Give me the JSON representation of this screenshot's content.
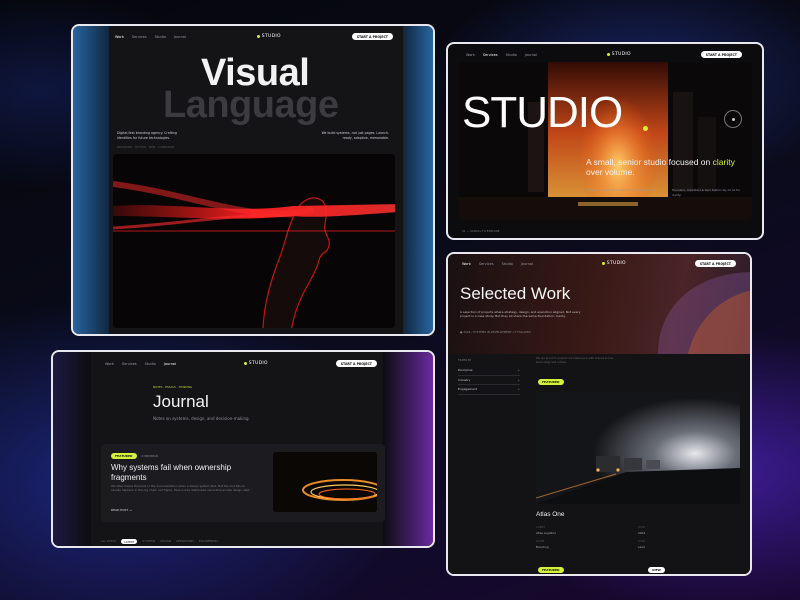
{
  "card1": {
    "nav": {
      "links": [
        "Work",
        "Services",
        "Studio",
        "Journal"
      ],
      "active": "Work",
      "logo": "STUDIO",
      "cta": "START A PROJECT"
    },
    "title_line1": "Visual",
    "title_line2": "Language",
    "left_caption": "Digital-first branding agency. Crafting identities for future technologies.",
    "right_caption": "We build systems, not just pages. Launch-ready, adaptive, memorable.",
    "meta_line": "BRANDING · MOTION · WEB · CAMPAIGNS"
  },
  "card2": {
    "nav": {
      "links": [
        "Work",
        "Services",
        "Studio",
        "Journal"
      ],
      "active": "Services",
      "logo": "STUDIO",
      "cta": "START A PROJECT"
    },
    "title": "STUDIO",
    "tagline_pre": "A small, senior studio focused on",
    "tagline_highlight": "clarity",
    "tagline_post": "over volume.",
    "small_left": "Strategy, design and motion for brands that ship.",
    "small_right": "Founders, marketers & tech teams rely on us for clarity.",
    "footer": "01 — SCROLL TO EXPLORE",
    "colors": {
      "accent": "#d4f23a"
    }
  },
  "card3": {
    "nav": {
      "links": [
        "Work",
        "Services",
        "Studio",
        "Journal"
      ],
      "active": "Studio",
      "logo": "STUDIO",
      "cta": "START A PROJECT"
    },
    "kicker": "NOTES · ESSAYS · THINKING",
    "title": "Journal",
    "subtitle": "Notes on systems, design, and decision-making.",
    "article": {
      "tag": "FEATURED",
      "date": "6 MIN READ",
      "headline": "Why systems fail when ownership fragments",
      "excerpt": "We often blame the tools or the documentation when a design system fails. But the root failure usually happens in the org chart, not Figma. Here is why distributed ownership erodes design debt.",
      "link": "READ POST →"
    },
    "filters": [
      "ALL POSTS",
      "LATEST",
      "SYSTEMS",
      "DESIGN",
      "OPERATIONS",
      "ENGINEERING"
    ],
    "active_filter": "LATEST"
  },
  "card4": {
    "nav": {
      "links": [
        "Work",
        "Services",
        "Studio",
        "Journal"
      ],
      "active": "Work",
      "logo": "STUDIO",
      "cta": "START A PROJECT"
    },
    "title": "Selected Work",
    "intro": "A selection of projects where strategy, design, and execution aligned. Not every project is a case study. But they all share the same foundation: clarity.",
    "note": "● 2024 / SYSTEMS IN DEVELOPMENT / 3 FOLLOWS",
    "filter_heading": "FILTER BY",
    "filters": [
      {
        "label": "Discipline",
        "sign": "+"
      },
      {
        "label": "Industry",
        "sign": "+"
      },
      {
        "label": "Engagement",
        "sign": "+"
      }
    ],
    "list_caption": "We are proud to present our latest work with brands across technology and culture.",
    "project": {
      "tag": "FEATURED",
      "name": "Atlas One",
      "meta": [
        {
          "k": "CLIENT",
          "v": "Atlas Logistics"
        },
        {
          "k": "YEAR",
          "v": "2024"
        },
        {
          "k": "SCOPE",
          "v": "Branding"
        },
        {
          "k": "ROLE",
          "v": "Lead"
        }
      ]
    },
    "bottom_tag": "FEATURED",
    "bottom_pill": "VIEW"
  }
}
